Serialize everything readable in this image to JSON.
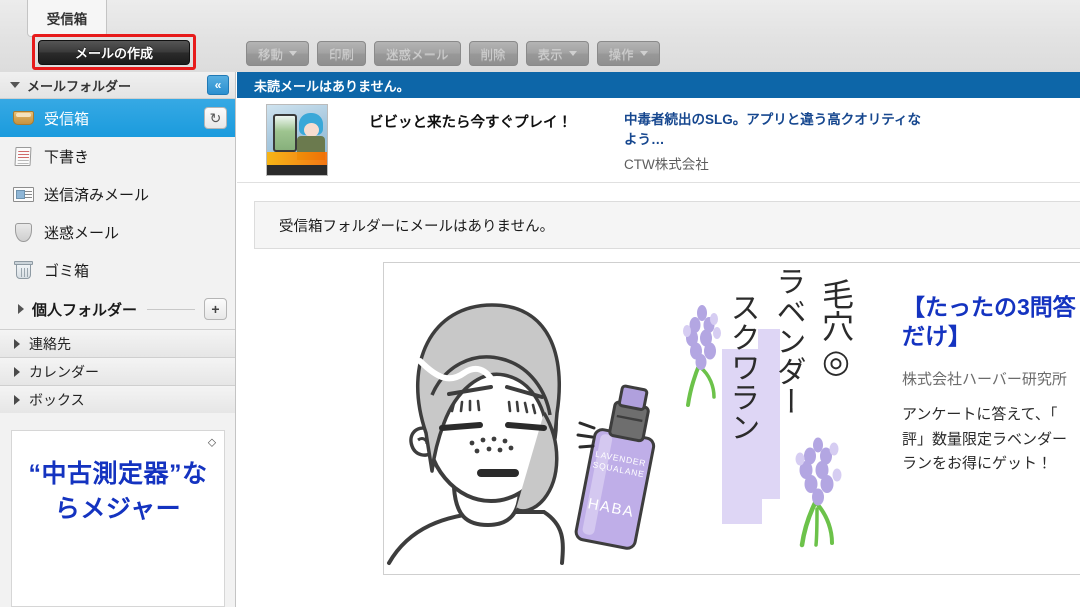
{
  "window": {
    "tab_label": "受信箱"
  },
  "compose": {
    "label": "メールの作成"
  },
  "toolbar": {
    "buttons": [
      {
        "label": "移動",
        "caret": true
      },
      {
        "label": "印刷",
        "caret": false
      },
      {
        "label": "迷惑メール",
        "caret": false
      },
      {
        "label": "削除",
        "caret": false
      },
      {
        "label": "表示",
        "caret": true
      },
      {
        "label": "操作",
        "caret": true
      }
    ]
  },
  "sidebar": {
    "folder_header": {
      "label": "メールフォルダー",
      "collapse_icon": "chevron-double-left-icon",
      "collapse_glyph": "«"
    },
    "folders": [
      {
        "label": "受信箱",
        "icon": "inbox-icon",
        "selected": true,
        "refresh_glyph": "↻"
      },
      {
        "label": "下書き",
        "icon": "draft-icon",
        "selected": false
      },
      {
        "label": "送信済みメール",
        "icon": "sent-mail-icon",
        "selected": false
      },
      {
        "label": "迷惑メール",
        "icon": "shield-icon",
        "selected": false
      },
      {
        "label": "ゴミ箱",
        "icon": "trash-icon",
        "selected": false
      }
    ],
    "personal_folder": {
      "label": "個人フォルダー",
      "add_glyph": "+"
    },
    "nav_sections": [
      {
        "label": "連絡先"
      },
      {
        "label": "カレンダー"
      },
      {
        "label": "ボックス"
      }
    ],
    "ad": {
      "info_glyph": "⬦",
      "text": "“中古測定器”ならメジャー"
    }
  },
  "main": {
    "unread_banner": "未読メールはありません。",
    "text_ad": {
      "catch": "ビビッと来たら今すぐプレイ！",
      "title_line1": "中毒者続出のSLG。アプリと違う高クオリティな",
      "title_line2": "よう…",
      "advertiser": "CTW株式会社"
    },
    "empty_message": "受信箱フォルダーにメールはありません。",
    "banner_ad": {
      "title_line1": "【たったの3問答",
      "title_line2": "だけ】",
      "advertiser": "株式会社ハーバー研究所",
      "body_line1": "アンケートに答えて、「",
      "body_line2": "評」数量限定ラベンダー",
      "body_line3": "ランをお得にゲット！",
      "illustration": {
        "vertical_text_1": "毛穴◎",
        "vertical_text_2": "ラベンダー",
        "vertical_text_3": "スクワラン",
        "bottle_brand": "HABA",
        "bottle_label_line1": "LAVENDER",
        "bottle_label_line2": "SQUALANE"
      }
    }
  },
  "colors": {
    "accent_blue": "#1b9bdd",
    "banner_blue": "#0d66a8",
    "ad_link_blue": "#16478f",
    "ad_title_blue": "#1433c0",
    "highlight_red": "#e71b1b",
    "sidebar_bg": "#f2f2f2",
    "topbar_bg": "#e8e8e8"
  }
}
